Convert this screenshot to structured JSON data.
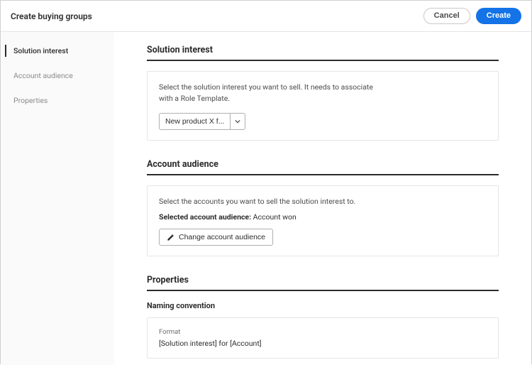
{
  "header": {
    "title": "Create buying groups",
    "cancel": "Cancel",
    "create": "Create"
  },
  "nav": {
    "items": [
      {
        "label": "Solution interest",
        "active": true
      },
      {
        "label": "Account audience",
        "active": false
      },
      {
        "label": "Properties",
        "active": false
      }
    ]
  },
  "sections": {
    "solution_interest": {
      "title": "Solution interest",
      "help": "Select the solution interest you want to sell. It needs to associate with a Role Template.",
      "combo_value": "New product X f..."
    },
    "account_audience": {
      "title": "Account audience",
      "help": "Select the accounts you want to sell the solution interest to.",
      "selected_label": "Selected account audience:",
      "selected_value": "Account won",
      "change_btn": "Change account audience"
    },
    "properties": {
      "title": "Properties",
      "naming_label": "Naming convention",
      "format_label": "Format",
      "format_value": "[Solution interest] for [Account]"
    }
  }
}
